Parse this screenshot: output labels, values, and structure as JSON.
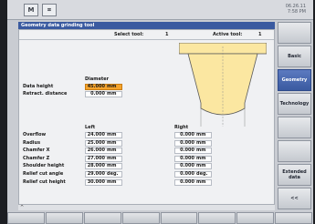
{
  "header": {
    "logo_left": "M",
    "logo_right": "⌗",
    "date": "06.26.11",
    "time": "7:58 PM"
  },
  "title": "Geometry data grinding tool",
  "toolbar": {
    "select_label": "Select tool:",
    "select_value": "1",
    "active_label": "Active tool:",
    "active_value": "1"
  },
  "diameter": {
    "header": "Diameter",
    "rows": [
      {
        "label": "Data height",
        "value": "45.000",
        "unit": "mm",
        "highlight": true
      },
      {
        "label": "Retract. distance",
        "value": "0.000",
        "unit": "mm",
        "highlight": false
      }
    ]
  },
  "sides": {
    "left_header": "Left",
    "right_header": "Right",
    "rows": [
      {
        "label": "Overflow",
        "left": "24.000",
        "left_unit": "mm",
        "right": "0.000",
        "right_unit": "mm"
      },
      {
        "label": "Radius",
        "left": "25.000",
        "left_unit": "mm",
        "right": "0.000",
        "right_unit": "mm"
      },
      {
        "label": "Chamfer X",
        "left": "26.000",
        "left_unit": "mm",
        "right": "0.000",
        "right_unit": "mm"
      },
      {
        "label": "Chamfer Z",
        "left": "27.000",
        "left_unit": "mm",
        "right": "0.000",
        "right_unit": "mm"
      },
      {
        "label": "Shoulder height",
        "left": "28.000",
        "left_unit": "mm",
        "right": "0.000",
        "right_unit": "mm"
      },
      {
        "label": "Relief cut angle",
        "left": "29.000",
        "left_unit": "deg.",
        "right": "0.000",
        "right_unit": "deg."
      },
      {
        "label": "Relief cut height",
        "left": "30.000",
        "left_unit": "mm",
        "right": "0.000",
        "right_unit": "mm"
      }
    ]
  },
  "softkeys": [
    {
      "label": "",
      "active": false
    },
    {
      "label": "Basic",
      "active": false
    },
    {
      "label": "Geometry",
      "active": true
    },
    {
      "label": "Technology",
      "active": false
    },
    {
      "label": "",
      "active": false
    },
    {
      "label": "",
      "active": false
    },
    {
      "label": "Extended data",
      "active": false
    },
    {
      "label": "<<",
      "active": false
    }
  ],
  "colors": {
    "title_bar": "#3a5aa0",
    "highlight_field": "#f4a32c",
    "tool_fill": "#fbe7a1"
  },
  "bottom_caret": "^"
}
